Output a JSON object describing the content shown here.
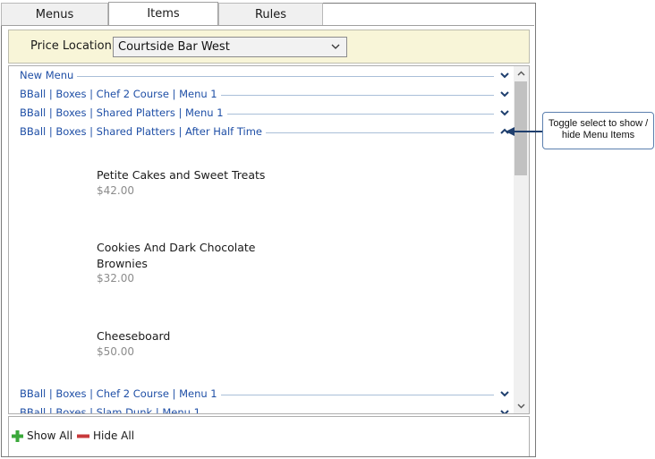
{
  "tabs": [
    {
      "label": "Menus",
      "active": false
    },
    {
      "label": "Items",
      "active": true
    },
    {
      "label": "Rules",
      "active": false
    }
  ],
  "price_location": {
    "label": "Price Location",
    "selected": "Courtside Bar West"
  },
  "menus_top": [
    {
      "label": "New Menu",
      "expanded": false
    },
    {
      "label": "BBall | Boxes | Chef 2 Course | Menu 1",
      "expanded": false
    },
    {
      "label": "BBall | Boxes | Shared Platters | Menu 1",
      "expanded": false
    },
    {
      "label": "BBall | Boxes | Shared Platters | After Half Time",
      "expanded": true
    }
  ],
  "items": [
    {
      "name_line1": "Petite Cakes and Sweet Treats",
      "name_line2": "",
      "price": "$42.00"
    },
    {
      "name_line1": "Cookies And Dark Chocolate",
      "name_line2": "Brownies",
      "price": "$32.00"
    },
    {
      "name_line1": "Cheeseboard",
      "name_line2": "",
      "price": "$50.00"
    }
  ],
  "menus_bottom": [
    {
      "label": "BBall | Boxes | Chef 2 Course | Menu 1",
      "expanded": false
    },
    {
      "label": "BBall | Boxes | Slam Dunk | Menu 1",
      "expanded": false
    }
  ],
  "footer": {
    "show_all": "Show All",
    "hide_all": "Hide All"
  },
  "callout": {
    "line1": "Toggle select to show /",
    "line2": "hide Menu Items"
  },
  "colors": {
    "menu_link": "#1f4fa6",
    "price_bar_bg": "#f8f5d8",
    "show_all_icon": "#3aa83a",
    "hide_all_icon": "#c8393b",
    "callout_arrow": "#1f3f6e"
  }
}
